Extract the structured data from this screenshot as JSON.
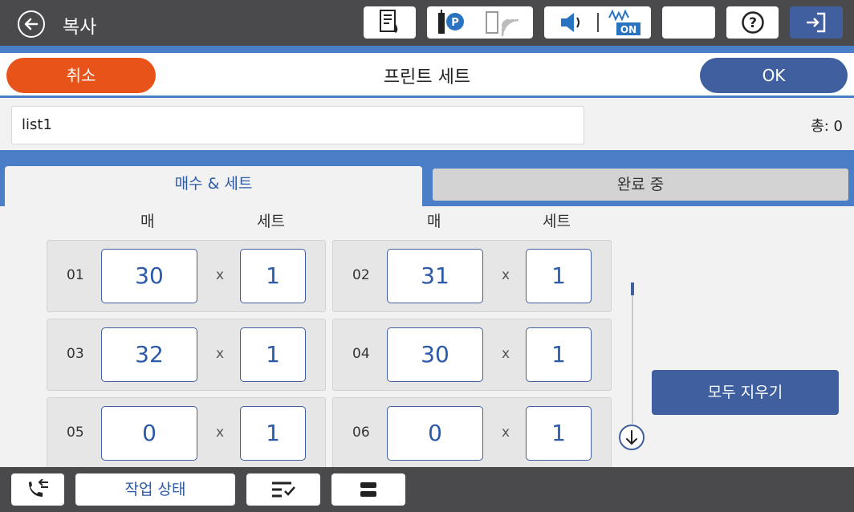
{
  "topbar": {
    "title": "복사",
    "icons": [
      "back-icon",
      "document-status-icon",
      "network-status-icon",
      "wifi-icon",
      "volume-icon",
      "eco-on-icon",
      "sleep-icon",
      "help-icon",
      "logout-icon"
    ],
    "eco_label": "ON"
  },
  "header": {
    "cancel_label": "취소",
    "title": "프린트 세트",
    "ok_label": "OK"
  },
  "list": {
    "name_value": "list1",
    "total_label": "총: 0"
  },
  "tabs": [
    {
      "label": "매수 & 세트",
      "active": true
    },
    {
      "label": "완료 중",
      "active": false
    }
  ],
  "grid": {
    "copies_header": "매",
    "sets_header": "세트",
    "times_symbol": "x",
    "rows": [
      {
        "num": "01",
        "copies": "30",
        "sets": "1"
      },
      {
        "num": "02",
        "copies": "31",
        "sets": "1"
      },
      {
        "num": "03",
        "copies": "32",
        "sets": "1"
      },
      {
        "num": "04",
        "copies": "30",
        "sets": "1"
      },
      {
        "num": "05",
        "copies": "0",
        "sets": "1"
      },
      {
        "num": "06",
        "copies": "0",
        "sets": "1"
      }
    ]
  },
  "actions": {
    "clear_all_label": "모두 지우기"
  },
  "bottombar": {
    "job_status_label": "작업 상태",
    "icons": [
      "fax-icon",
      "job-queue-icon",
      "stop-icon"
    ]
  },
  "colors": {
    "accent_blue": "#3f5f9e",
    "band_blue": "#4a7fc8",
    "cancel_orange": "#e8531a",
    "dark_bar": "#4a4a4c",
    "text_blue": "#2c5aa8"
  }
}
